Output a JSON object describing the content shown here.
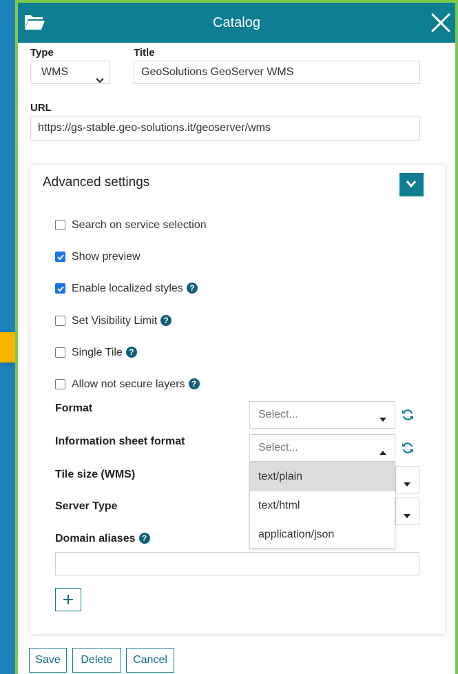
{
  "window": {
    "title": "Catalog",
    "title_bar_color": "#0f7e92",
    "border_color": "#7ec84a",
    "background_color": "#2b8fc4"
  },
  "form": {
    "type_label": "Type",
    "type_value": "WMS",
    "title_label": "Title",
    "title_value": "GeoSolutions GeoServer WMS",
    "url_label": "URL",
    "url_value": "https://gs-stable.geo-solutions.it/geoserver/wms"
  },
  "advanced": {
    "heading": "Advanced settings",
    "checkboxes": [
      {
        "label": "Search on service selection",
        "checked": false,
        "help": false
      },
      {
        "label": "Show preview",
        "checked": true,
        "help": false
      },
      {
        "label": "Enable localized styles",
        "checked": true,
        "help": true
      },
      {
        "label": "Set Visibility Limit",
        "checked": false,
        "help": true
      },
      {
        "label": "Single Tile",
        "checked": false,
        "help": true
      },
      {
        "label": "Allow not secure layers",
        "checked": false,
        "help": true
      }
    ],
    "format_label": "Format",
    "format_placeholder": "Select...",
    "info_sheet_label": "Information sheet format",
    "info_sheet_placeholder": "Select...",
    "info_sheet_options": [
      "text/plain",
      "text/html",
      "application/json"
    ],
    "info_sheet_highlighted": "text/plain",
    "tile_size_label": "Tile size (WMS)",
    "server_type_label": "Server Type",
    "domain_aliases_label": "Domain aliases",
    "domain_aliases_value": "",
    "add_button_symbol": "+"
  },
  "footer": {
    "save_label": "Save",
    "delete_label": "Delete",
    "cancel_label": "Cancel"
  },
  "icons": {
    "folder": "folder-open-icon",
    "close": "close-icon",
    "help": "question-circle-icon",
    "refresh": "refresh-icon",
    "help_glyph": "?"
  },
  "colors": {
    "accent": "#0f7e92",
    "checkbox_checked": "#1a73e8",
    "highlight_marker": "#f7b500"
  }
}
